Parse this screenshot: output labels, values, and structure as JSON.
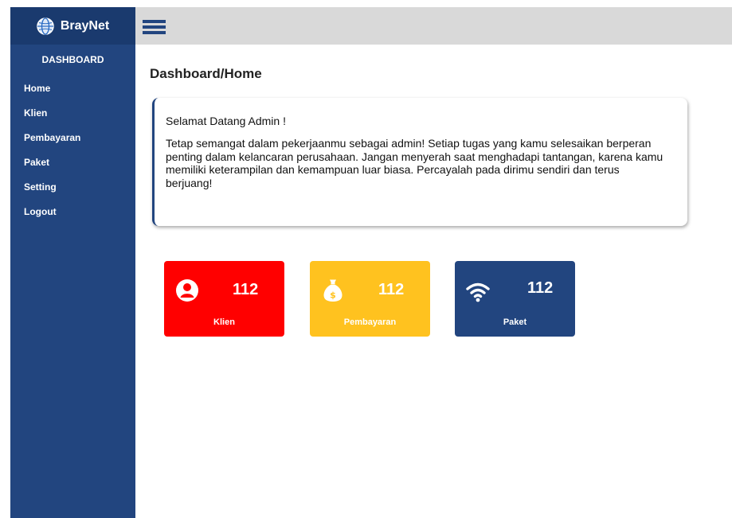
{
  "sidebar": {
    "brand": "BrayNet",
    "section": "DASHBOARD",
    "items": [
      {
        "label": "Home"
      },
      {
        "label": "Klien"
      },
      {
        "label": "Pembayaran"
      },
      {
        "label": "Paket"
      },
      {
        "label": "Setting"
      },
      {
        "label": "Logout"
      }
    ]
  },
  "main": {
    "breadcrumb": "Dashboard/Home",
    "welcome": {
      "title": "Selamat Datang Admin !",
      "message": "Tetap semangat dalam pekerjaanmu sebagai admin! Setiap tugas yang kamu selesaikan berperan penting dalam kelancaran perusahaan. Jangan menyerah saat menghadapi tantangan, karena kamu memiliki keterampilan dan kemampuan luar biasa. Percayalah pada dirimu sendiri dan terus berjuang!"
    },
    "stats": [
      {
        "label": "Klien",
        "value": "112",
        "icon": "user-icon",
        "color": "#ff0000"
      },
      {
        "label": "Pembayaran",
        "value": "112",
        "icon": "money-bag-icon",
        "color": "#ffc21f"
      },
      {
        "label": "Paket",
        "value": "112",
        "icon": "wifi-icon",
        "color": "#22457f"
      }
    ]
  },
  "colors": {
    "sidebar": "#22457f",
    "topbar": "#d9d9d9"
  }
}
